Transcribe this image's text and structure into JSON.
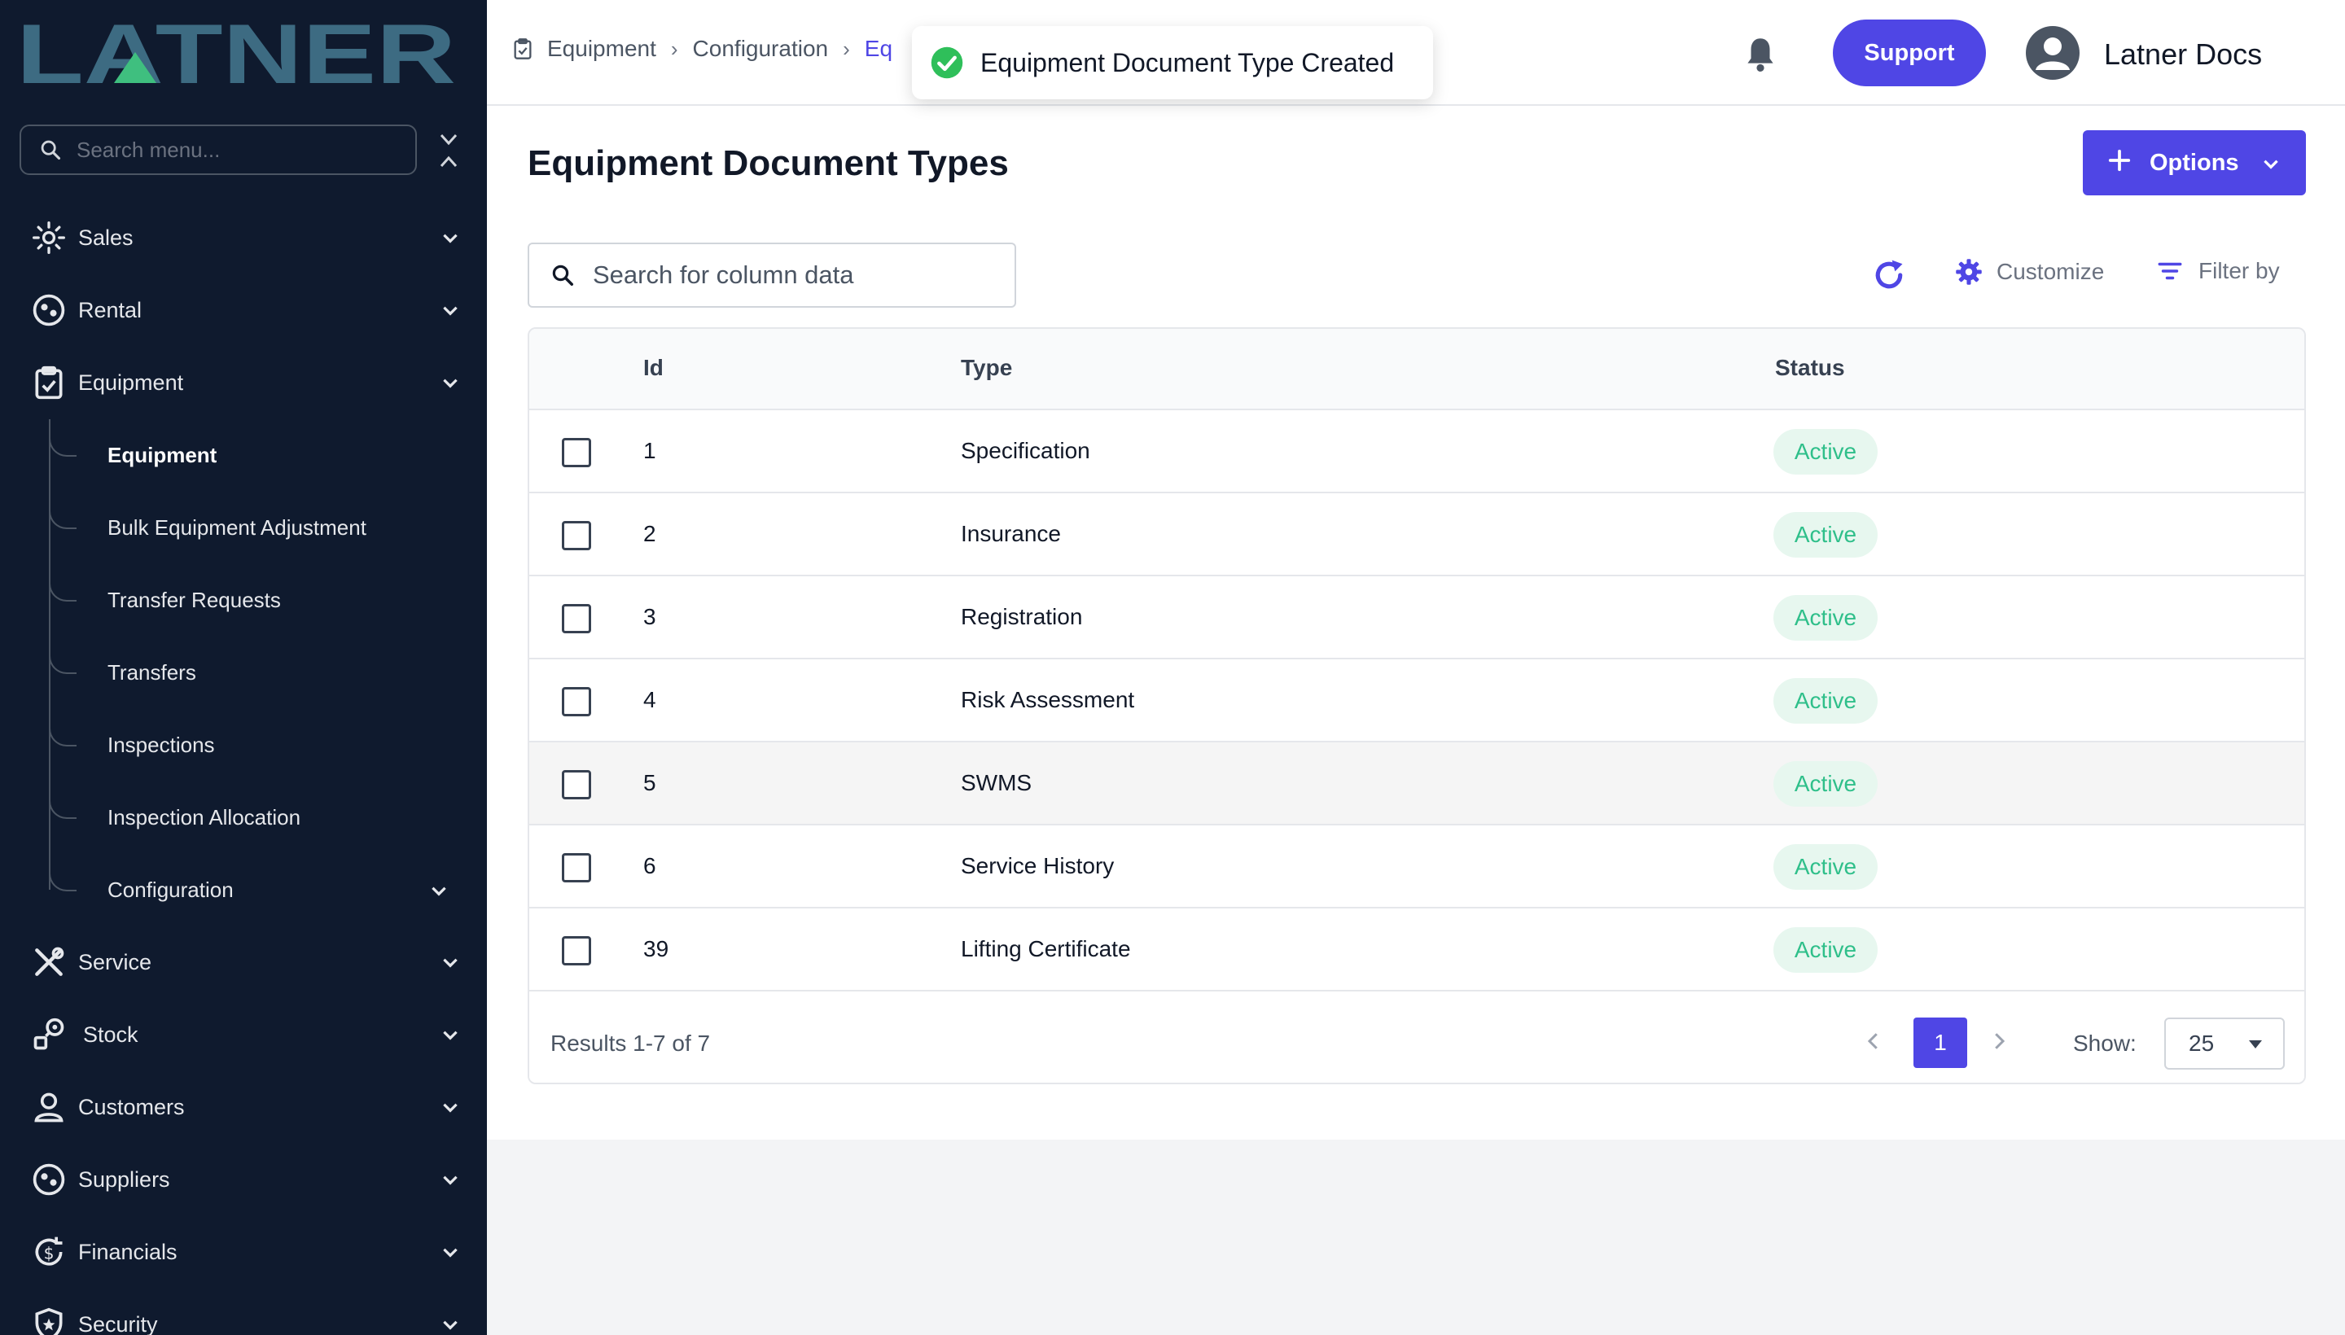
{
  "app": {
    "logo_text": "LATNER"
  },
  "sidebar": {
    "search_placeholder": "Search menu...",
    "items": [
      {
        "label": "Sales",
        "icon": "sales-icon"
      },
      {
        "label": "Rental",
        "icon": "rental-icon"
      },
      {
        "label": "Equipment",
        "icon": "clipboard-icon"
      },
      {
        "label": "Service",
        "icon": "tools-icon"
      },
      {
        "label": "Stock",
        "icon": "stock-icon"
      },
      {
        "label": "Customers",
        "icon": "user-icon"
      },
      {
        "label": "Suppliers",
        "icon": "suppliers-icon"
      },
      {
        "label": "Financials",
        "icon": "dollar-icon"
      },
      {
        "label": "Security",
        "icon": "shield-icon"
      }
    ],
    "equipment_sub": [
      {
        "label": "Equipment"
      },
      {
        "label": "Bulk Equipment Adjustment"
      },
      {
        "label": "Transfer Requests"
      },
      {
        "label": "Transfers"
      },
      {
        "label": "Inspections"
      },
      {
        "label": "Inspection Allocation"
      },
      {
        "label": "Configuration"
      }
    ]
  },
  "header": {
    "breadcrumb": [
      "Equipment",
      "Configuration",
      "Eq"
    ],
    "support_label": "Support",
    "user_name": "Latner Docs"
  },
  "toast": {
    "message": "Equipment Document Type Created"
  },
  "main": {
    "title": "Equipment Document Types",
    "options_label": "Options",
    "search_placeholder": "Search for column data",
    "customize_label": "Customize",
    "filter_label": "Filter by",
    "columns": [
      "Id",
      "Type",
      "Status"
    ],
    "rows": [
      {
        "id": "1",
        "type": "Specification",
        "status": "Active"
      },
      {
        "id": "2",
        "type": "Insurance",
        "status": "Active"
      },
      {
        "id": "3",
        "type": "Registration",
        "status": "Active"
      },
      {
        "id": "4",
        "type": "Risk Assessment",
        "status": "Active"
      },
      {
        "id": "5",
        "type": "SWMS",
        "status": "Active"
      },
      {
        "id": "6",
        "type": "Service History",
        "status": "Active"
      },
      {
        "id": "39",
        "type": "Lifting Certificate",
        "status": "Active"
      }
    ],
    "results_text": "Results 1-7 of 7",
    "current_page": "1",
    "show_label": "Show:",
    "page_size": "25"
  },
  "colors": {
    "accent": "#4f46e5",
    "sidebar_bg": "#0f1a2e",
    "logo": "#3d6b82",
    "success": "#2fbf8a"
  }
}
